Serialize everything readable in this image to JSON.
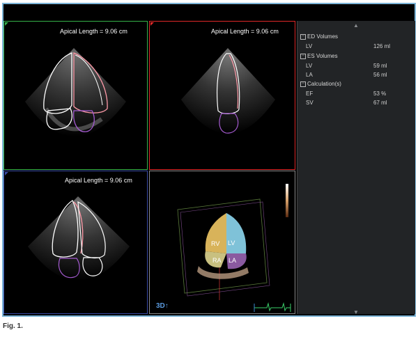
{
  "panels": {
    "top_left": {
      "caption": "Apical Length = 9.06 cm"
    },
    "top_right": {
      "caption": "Apical Length = 9.06 cm"
    },
    "bottom_left": {
      "caption": "Apical Length = 9.06 cm"
    },
    "render_3d": {
      "mode_label": "3D↑",
      "chambers": [
        "RV",
        "LV",
        "RA",
        "LA"
      ]
    }
  },
  "results": {
    "sections": [
      {
        "title": "ED Volumes",
        "rows": [
          {
            "label": "LV",
            "value": "126 ml"
          }
        ]
      },
      {
        "title": "ES Volumes",
        "rows": [
          {
            "label": "LV",
            "value": "59 ml"
          },
          {
            "label": "LA",
            "value": "56 ml"
          }
        ]
      },
      {
        "title": "Calculation(s)",
        "rows": [
          {
            "label": "EF",
            "value": "53 %"
          },
          {
            "label": "SV",
            "value": "67 ml"
          }
        ]
      }
    ]
  },
  "figure_caption": "Fig. 1.",
  "colors": {
    "frame_border": "#7ab3d6",
    "panel_green": "#35b34a",
    "panel_red": "#e02828",
    "panel_blue": "#3a4aa8",
    "sidebar_bg": "#222426"
  },
  "icons": {
    "collapse": "minus-box-icon",
    "scroll_up": "caret-up-icon",
    "scroll_down": "caret-down-icon"
  }
}
